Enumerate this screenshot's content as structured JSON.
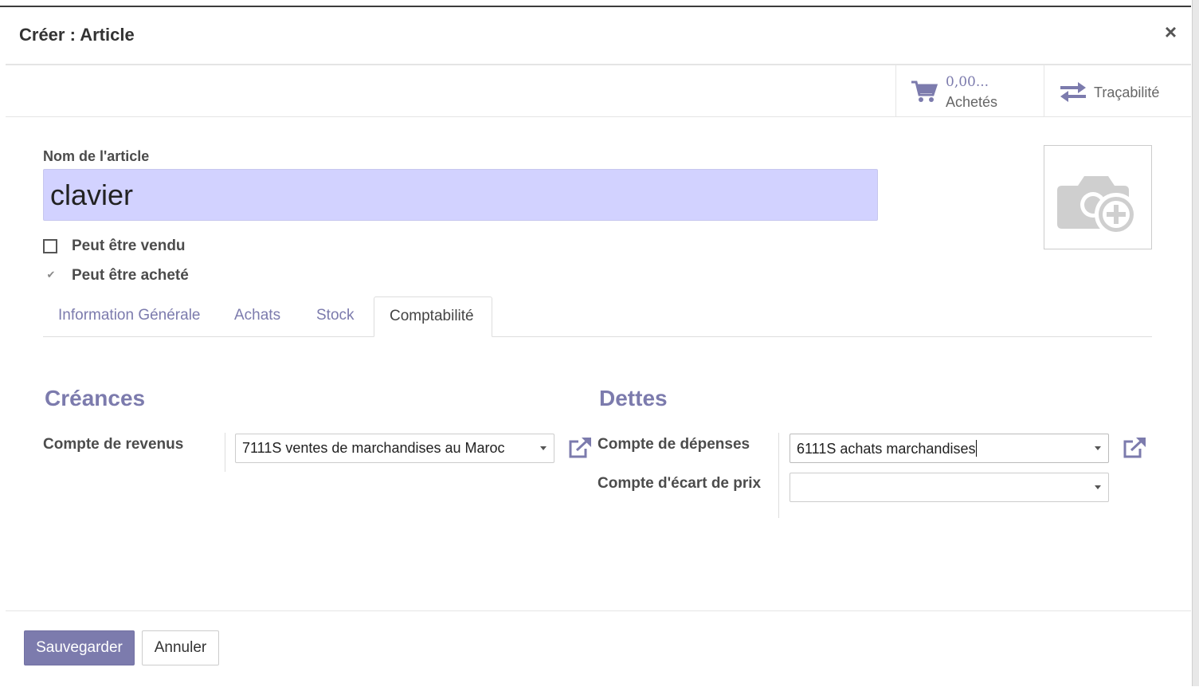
{
  "dialog": {
    "title": "Créer : Article",
    "close_glyph": "×"
  },
  "stat_buttons": {
    "purchased": {
      "value": "0,00...",
      "label": "Achetés",
      "icon": "shopping-cart-icon"
    },
    "traceability": {
      "label": "Traçabilité",
      "icon": "exchange-arrows-icon"
    }
  },
  "form": {
    "name_label": "Nom de l'article",
    "name_value": "clavier",
    "can_be_sold": {
      "label": "Peut être vendu",
      "checked": false
    },
    "can_be_purchased": {
      "label": "Peut être acheté",
      "checked": true,
      "tick": "✔"
    },
    "image_icon": "camera-plus-icon"
  },
  "tabs": [
    {
      "label": "Information Générale",
      "active": false
    },
    {
      "label": "Achats",
      "active": false
    },
    {
      "label": "Stock",
      "active": false
    },
    {
      "label": "Comptabilité",
      "active": true
    }
  ],
  "accounting": {
    "receivables": {
      "title": "Créances",
      "income_account_label": "Compte de revenus",
      "income_account_value": "7111S ventes de marchandises au Maroc"
    },
    "payables": {
      "title": "Dettes",
      "expense_account_label": "Compte de dépenses",
      "expense_account_value": "6111S achats marchandises",
      "price_difference_label": "Compte d'écart de prix",
      "price_difference_value": ""
    }
  },
  "footer": {
    "save_label": "Sauvegarder",
    "cancel_label": "Annuler"
  },
  "colors": {
    "primary": "#7c7bad",
    "input_highlight": "#d2d2ff"
  }
}
